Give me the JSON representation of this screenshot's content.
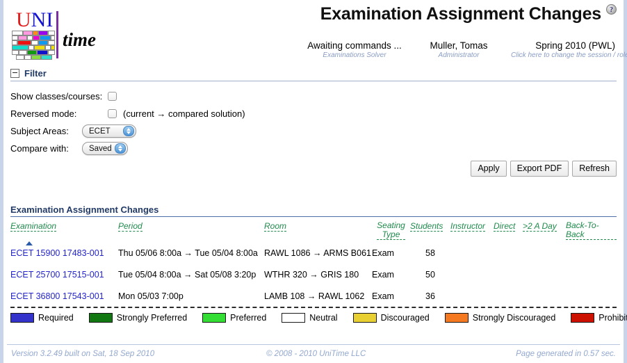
{
  "header": {
    "title": "Examination Assignment Changes",
    "help_icon": "question-mark-icon",
    "logo": {
      "uni_u": "U",
      "uni_n": "NI",
      "time": "time"
    },
    "status": [
      {
        "main": "Awaiting commands ...",
        "sub": "Examinations Solver"
      },
      {
        "main": "Muller, Tomas",
        "sub": "Administrator"
      },
      {
        "main": "Spring 2010 (PWL)",
        "sub": "Click here to change the session / role."
      }
    ]
  },
  "filter": {
    "section_title": "Filter",
    "show_classes_label": "Show classes/courses:",
    "show_classes_checked": false,
    "reversed_mode_label": "Reversed mode:",
    "reversed_mode_checked": false,
    "reversed_mode_note": "(current → compared solution)",
    "subject_areas_label": "Subject Areas:",
    "subject_areas_value": "ECET",
    "compare_with_label": "Compare with:",
    "compare_with_value": "Saved"
  },
  "buttons": {
    "apply": "Apply",
    "export_pdf": "Export PDF",
    "refresh": "Refresh"
  },
  "table": {
    "caption": "Examination Assignment Changes",
    "columns": [
      "Examination",
      "Period",
      "Room",
      "Seating Type",
      "Students",
      "Instructor",
      "Direct",
      ">2 A Day",
      "Back-To-Back"
    ],
    "sorted_by": "Examination",
    "sort_direction": "ascending",
    "rows": [
      {
        "examination": "ECET 15900 17483-001",
        "period": "Thu 05/06 8:00a → Tue 05/04 8:00a",
        "room": "RAWL 1086 → ARMS B061",
        "seating_type": "Exam",
        "students": "58",
        "instructor": "",
        "direct": "",
        "two_a_day": "",
        "back_to_back": ""
      },
      {
        "examination": "ECET 25700 17515-001",
        "period": "Tue 05/04 8:00a → Sat 05/08 3:20p",
        "room": "WTHR 320 → GRIS 180",
        "seating_type": "Exam",
        "students": "50",
        "instructor": "",
        "direct": "",
        "two_a_day": "",
        "back_to_back": ""
      },
      {
        "examination": "ECET 36800 17543-001",
        "period": "Mon 05/03 7:00p",
        "room": "LAMB 108 → RAWL 1062",
        "seating_type": "Exam",
        "students": "36",
        "instructor": "",
        "direct": "",
        "two_a_day": "",
        "back_to_back": ""
      }
    ]
  },
  "legend": [
    {
      "label": "Required",
      "color": "#3333cc"
    },
    {
      "label": "Strongly Preferred",
      "color": "#117711"
    },
    {
      "label": "Preferred",
      "color": "#33dd33"
    },
    {
      "label": "Neutral",
      "color": "#ffffff"
    },
    {
      "label": "Discouraged",
      "color": "#e8d033"
    },
    {
      "label": "Strongly Discouraged",
      "color": "#f47920"
    },
    {
      "label": "Prohibited",
      "color": "#cc1100"
    }
  ],
  "footer": {
    "version": "Version 3.2.49 built on Sat, 18 Sep 2010",
    "copyright": "© 2008 - 2010 UniTime LLC",
    "generated": "Page generated in 0.57 sec."
  }
}
